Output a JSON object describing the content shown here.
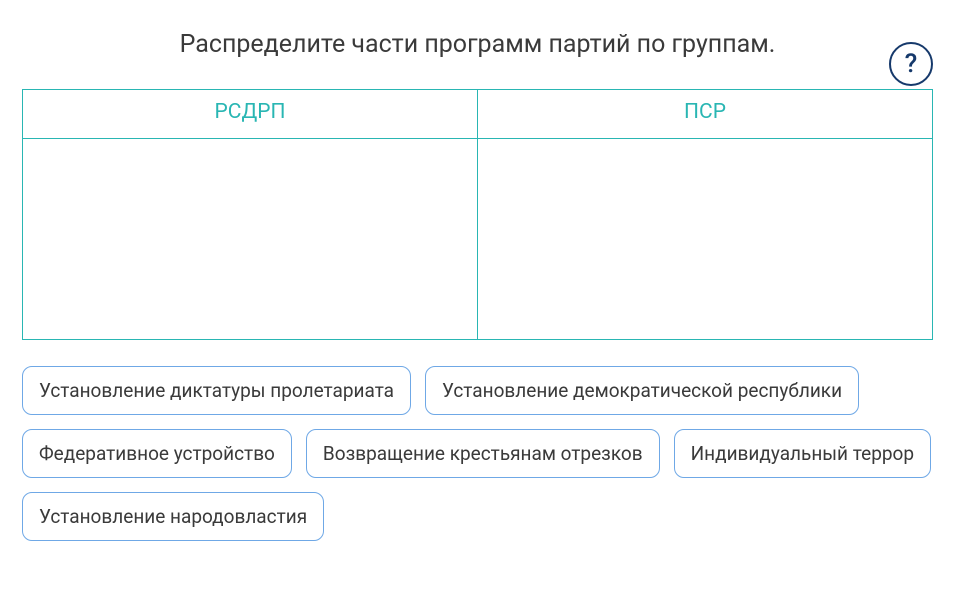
{
  "title": "Распределите части программ партий по группам.",
  "help_icon": "?",
  "groups": [
    {
      "name": "РСДРП"
    },
    {
      "name": "ПСР"
    }
  ],
  "items": [
    {
      "label": "Установление диктатуры пролетариата"
    },
    {
      "label": "Установление демократической республики"
    },
    {
      "label": "Федеративное устройство"
    },
    {
      "label": "Возвращение крестьянам отрезков"
    },
    {
      "label": "Индивидуальный террор"
    },
    {
      "label": "Установление народовластия"
    }
  ]
}
